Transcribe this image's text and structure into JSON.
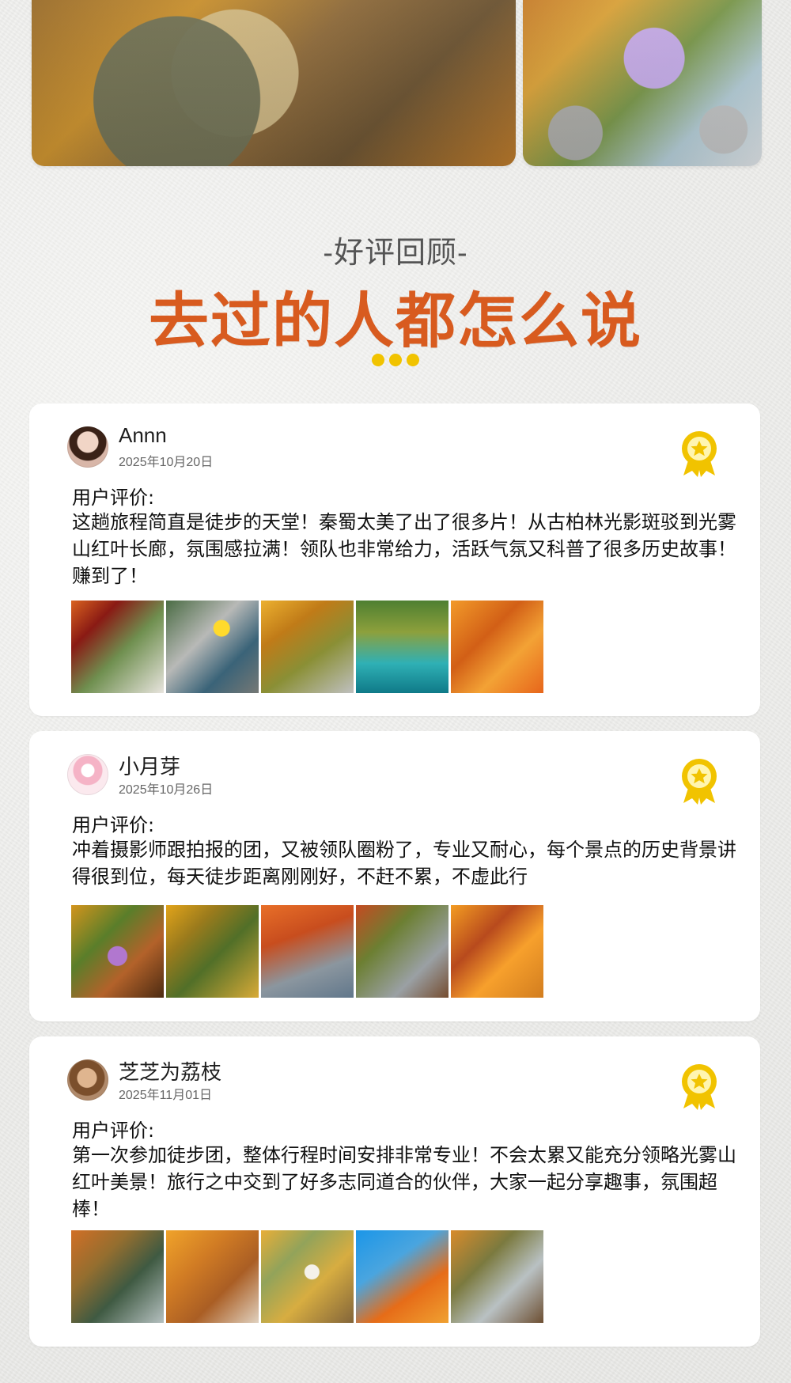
{
  "section": {
    "subtitle": "-好评回顾-",
    "title": "去过的人都怎么说"
  },
  "reviews": [
    {
      "username": "Annn",
      "date": "2025年10月20日",
      "label": "用户评价:",
      "text": "这趟旅程简直是徒步的天堂！秦蜀太美了出了很多片！从古柏林光影斑驳到光雾山红叶长廊，氛围感拉满！领队也非常给力，活跃气氛又科普了很多历史故事！赚到了！"
    },
    {
      "username": "小月芽",
      "date": "2025年10月26日",
      "label": "用户评价:",
      "text": "冲着摄影师跟拍报的团，又被领队圈粉了，专业又耐心，每个景点的历史背景讲得很到位，每天徒步距离刚刚好，不赶不累，不虚此行"
    },
    {
      "username": "芝芝为荔枝",
      "date": "2025年11月01日",
      "label": "用户评价:",
      "text": "第一次参加徒步团，整体行程时间安排非常专业！不会太累又能充分领略光雾山红叶美景！旅行之中交到了好多志同道合的伙伴，大家一起分享趣事，氛围超棒！"
    }
  ],
  "colors": {
    "title": "#d85b1f",
    "dots": "#f1c300",
    "badge": "#f1c300"
  }
}
